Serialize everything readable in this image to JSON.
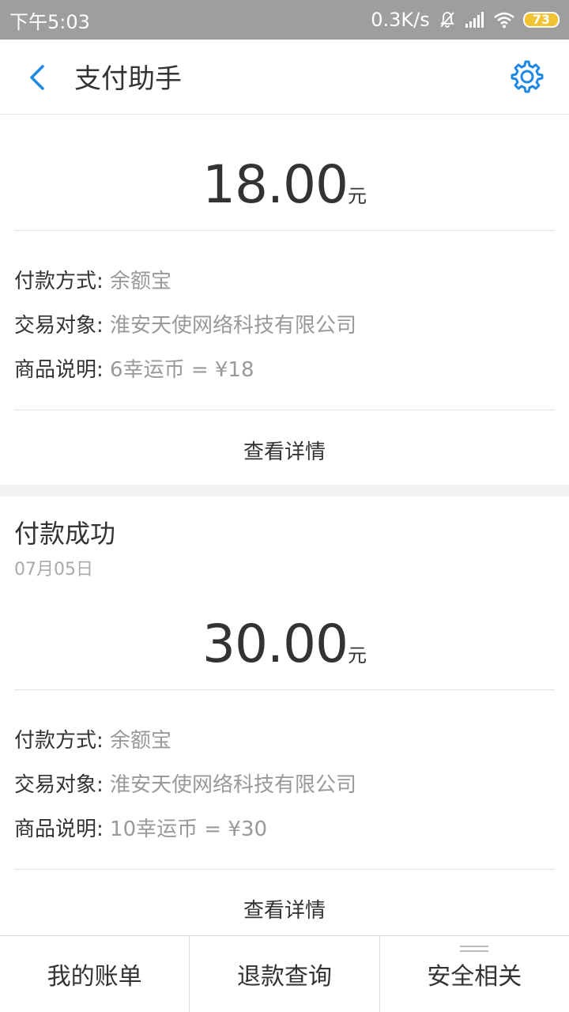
{
  "status_bar": {
    "time": "下午5:03",
    "speed": "0.3K/s",
    "battery": "73"
  },
  "header": {
    "title": "支付助手"
  },
  "transactions": [
    {
      "amount": "18.00",
      "unit": "元",
      "method_label": "付款方式:",
      "method_value": "余额宝",
      "target_label": "交易对象:",
      "target_value": "淮安天使网络科技有限公司",
      "desc_label": "商品说明:",
      "desc_value": "6幸运币 = ¥18",
      "detail_label": "查看详情"
    },
    {
      "status": "付款成功",
      "date": "07月05日",
      "amount": "30.00",
      "unit": "元",
      "method_label": "付款方式:",
      "method_value": "余额宝",
      "target_label": "交易对象:",
      "target_value": "淮安天使网络科技有限公司",
      "desc_label": "商品说明:",
      "desc_value": "10幸运币 = ¥30",
      "detail_label": "查看详情"
    }
  ],
  "tabs": [
    "我的账单",
    "退款查询",
    "安全相关"
  ],
  "colors": {
    "accent": "#1e88e5",
    "status_bar": "#9e9e9e",
    "battery": "#f1c232"
  }
}
